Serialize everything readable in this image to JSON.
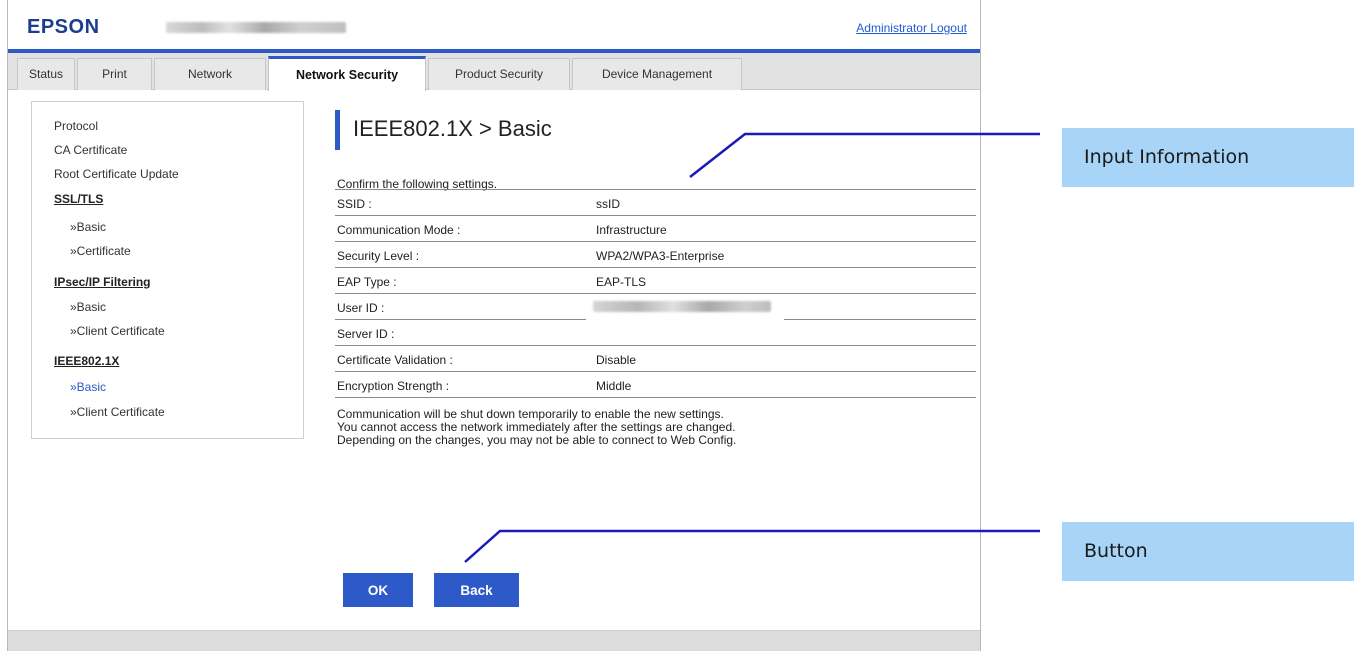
{
  "header": {
    "logo": "EPSON",
    "admin_logout": "Administrator Logout"
  },
  "tabs": [
    {
      "label": "Status"
    },
    {
      "label": "Print"
    },
    {
      "label": "Network"
    },
    {
      "label": "Network Security",
      "active": true
    },
    {
      "label": "Product Security"
    },
    {
      "label": "Device Management"
    }
  ],
  "sidebar": {
    "items": [
      {
        "label": "Protocol"
      },
      {
        "label": "CA Certificate"
      },
      {
        "label": "Root Certificate Update"
      },
      {
        "label": "SSL/TLS"
      },
      {
        "label": "»Basic"
      },
      {
        "label": "»Certificate"
      },
      {
        "label": "IPsec/IP Filtering"
      },
      {
        "label": "»Basic"
      },
      {
        "label": "»Client Certificate"
      },
      {
        "label": "IEEE802.1X"
      },
      {
        "label": "»Basic",
        "active": true
      },
      {
        "label": "»Client Certificate"
      }
    ]
  },
  "main": {
    "title": "IEEE802.1X > Basic",
    "confirm": "Confirm the following settings.",
    "rows": [
      {
        "label": "SSID :",
        "value": "ssID"
      },
      {
        "label": "Communication Mode :",
        "value": "Infrastructure"
      },
      {
        "label": "Security Level :",
        "value": "WPA2/WPA3-Enterprise"
      },
      {
        "label": "EAP Type :",
        "value": "EAP-TLS"
      },
      {
        "label": "User ID :",
        "value": ""
      },
      {
        "label": "Server ID :",
        "value": ""
      },
      {
        "label": "Certificate Validation :",
        "value": "Disable"
      },
      {
        "label": "Encryption Strength :",
        "value": "Middle"
      }
    ],
    "notice": [
      "Communication will be shut down temporarily to enable the new settings.",
      "You cannot access the network immediately after the settings are changed.",
      "Depending on the changes, you may not be able to connect to Web Config."
    ],
    "ok_button": "OK",
    "back_button": "Back"
  },
  "callouts": {
    "input_information": "Input Information",
    "button": "Button"
  },
  "colors": {
    "accent": "#2d5ac8",
    "callout_bg": "#a8d5f7",
    "link": "#1f5bd6"
  }
}
